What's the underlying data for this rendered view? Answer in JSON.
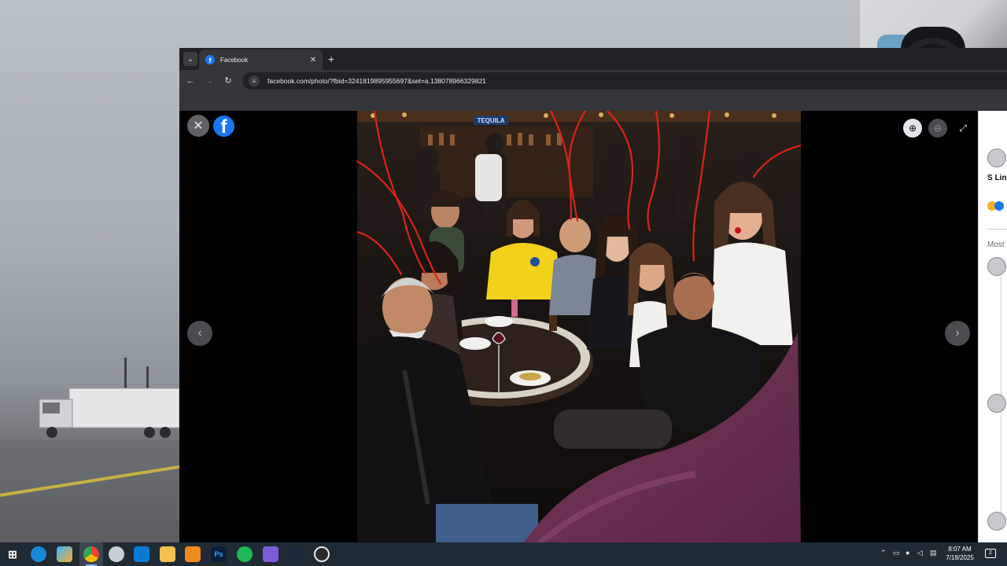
{
  "browser": {
    "tab": {
      "title": "Facebook",
      "favicon": "facebook-icon"
    },
    "url": "facebook.com/photo/?fbid=3241819895955697&set=a.138078966329821",
    "icons": {
      "tab_list": "chevron-down-icon",
      "close_tab": "close-icon",
      "new_tab": "plus-icon",
      "back": "arrow-left-icon",
      "forward": "arrow-right-icon",
      "reload": "reload-icon",
      "site_info": "tune-icon"
    }
  },
  "viewer": {
    "photo_sign": "TEQUILA",
    "icons": [
      "close-icon",
      "facebook-logo",
      "chevron-left-icon",
      "chevron-right-icon",
      "zoom-in-icon",
      "zoom-out-icon",
      "fullscreen-icon"
    ]
  },
  "sidebar": {
    "author_name": "S Line",
    "comments_filter": "Most"
  },
  "taskbar": {
    "time": "8:07 AM",
    "date": "7/18/2025",
    "notification_count": "2",
    "apps": [
      "windows-start-icon",
      "edge-icon",
      "copilot-icon",
      "chrome-icon",
      "app-icon",
      "vscode-icon",
      "file-explorer-icon",
      "sublime-text-icon",
      "photoshop-icon",
      "spotify-icon",
      "discord-icon",
      "steam-icon",
      "obs-icon"
    ],
    "app_labels": {
      "photoshop": "Ps"
    }
  },
  "colors": {
    "facebook_blue": "#1877f2",
    "chrome_dark": "#202124",
    "toolbar": "#35363a",
    "annotation_red": "#d9231b",
    "taskbar": "#1f2a33"
  }
}
